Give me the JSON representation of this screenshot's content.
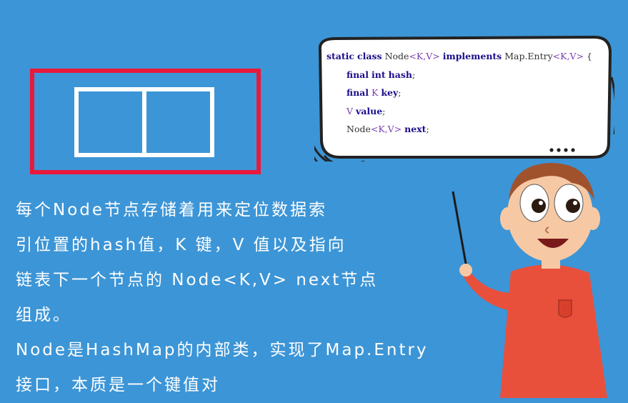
{
  "code": {
    "line1": {
      "kw1": "static",
      "kw2": "class",
      "name": "Node",
      "gen": "<K,V>",
      "kw3": "implements",
      "iface": "Map.Entry",
      "gen2": "<K,V>",
      "brace": "{"
    },
    "line2": {
      "kw1": "final",
      "kw2": "int",
      "field": "hash",
      "semi": ";"
    },
    "line3": {
      "kw1": "final",
      "type": "K",
      "field": "key",
      "semi": ";"
    },
    "line4": {
      "type": "V",
      "field": "value",
      "semi": ";"
    },
    "line5": {
      "name": "Node",
      "gen": "<K,V>",
      "field": "next",
      "semi": ";"
    }
  },
  "description": {
    "line1": "每个Node节点存储着用来定位数据索",
    "line2": "引位置的hash值，K 键，V 值以及指向",
    "line3": "链表下一个节点的 Node<K,V> next节点",
    "line4": "组成。",
    "line5": "Node是HashMap的内部类，实现了Map.Entry",
    "line6": "接口，本质是一个键值对"
  },
  "colors": {
    "background": "#3c95d6",
    "frame": "#e8193c",
    "cells": "#ffffff",
    "shirt": "#e8503c",
    "hair": "#a0522d"
  }
}
